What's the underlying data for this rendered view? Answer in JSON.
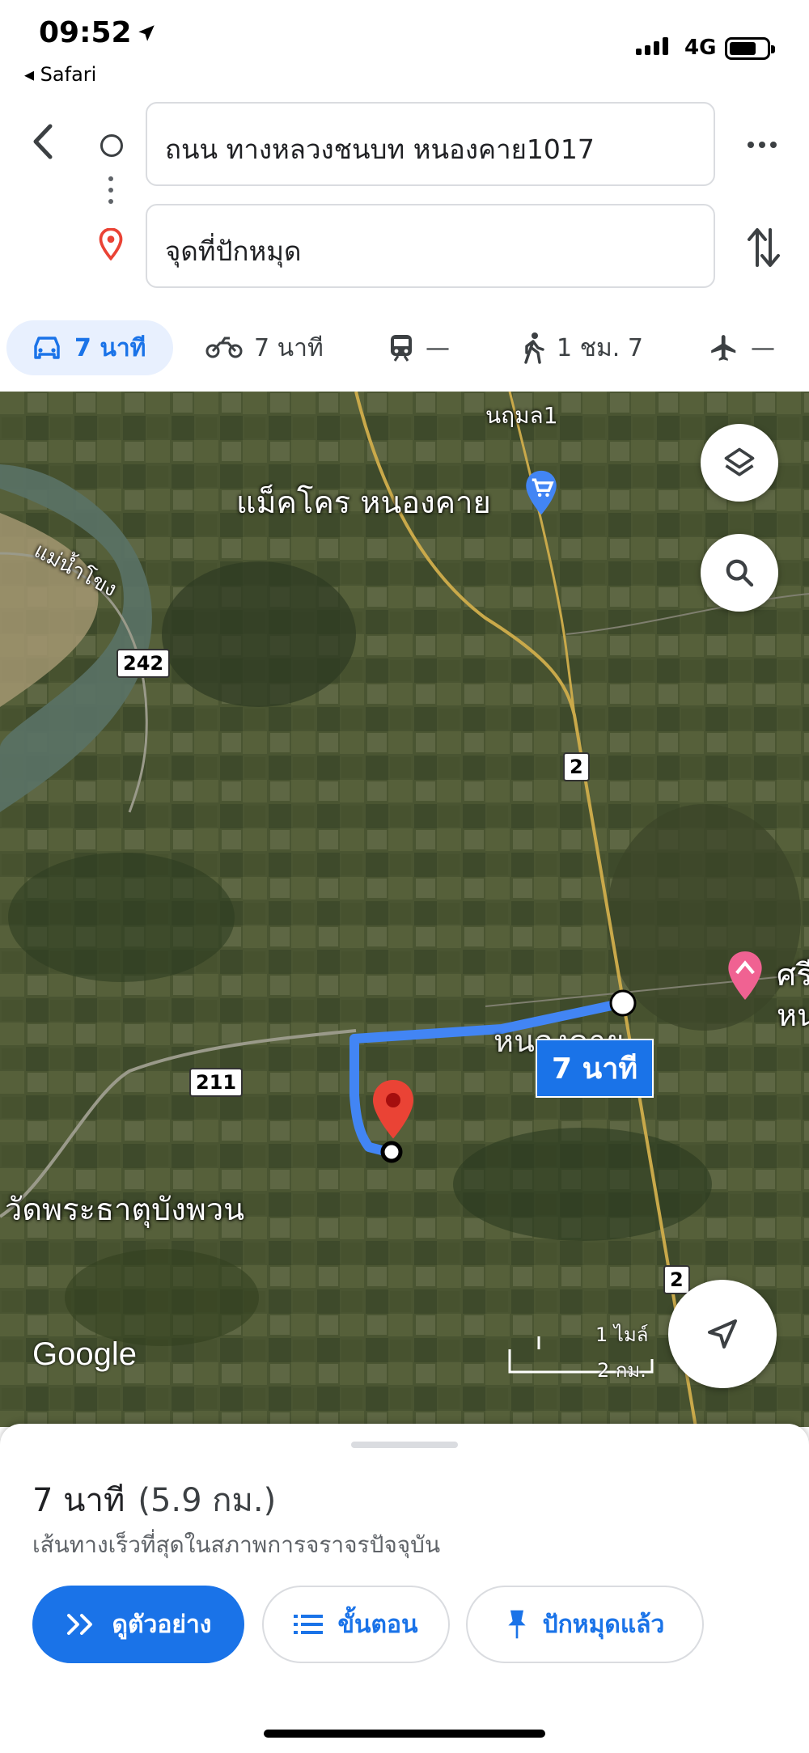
{
  "status_bar": {
    "time": "09:52",
    "back_app": "◂ Safari",
    "network": "4G"
  },
  "directions": {
    "origin": "ถนน ทางหลวงชนบท หนองคาย1017",
    "destination": "จุดที่ปักหมุด"
  },
  "modes": [
    {
      "name": "car",
      "label": "7 นาที"
    },
    {
      "name": "motorcycle",
      "label": "7 นาที"
    },
    {
      "name": "transit",
      "label": "—"
    },
    {
      "name": "walk",
      "label": "1 ชม. 7"
    },
    {
      "name": "flight",
      "label": "—"
    }
  ],
  "map": {
    "labels": {
      "makro": "แม็คโคร หนองคาย",
      "river": "แม่น้ำโขง",
      "temple": "วัดพระธาตุบังพวน",
      "village_top": "นฤมล1",
      "town": "หนองคาย",
      "poi_right": "ศรี",
      "poi_right2": "หน"
    },
    "shields": [
      "242",
      "2",
      "211",
      "2"
    ],
    "eta_badge": "7 นาที",
    "attribution": "Google",
    "scale_imperial": "1 ไมล์",
    "scale_metric": "2 กม.",
    "colors": {
      "route": "#4285f4",
      "pin": "#ea4335"
    }
  },
  "sheet": {
    "duration": "7 นาที",
    "distance": "(5.9 กม.)",
    "subtitle": "เส้นทางเร็วที่สุดในสภาพการจราจรปัจจุบัน",
    "preview_label": "ดูตัวอย่าง",
    "steps_label": "ขั้นตอน",
    "pinned_label": "ปักหมุดแล้ว"
  }
}
